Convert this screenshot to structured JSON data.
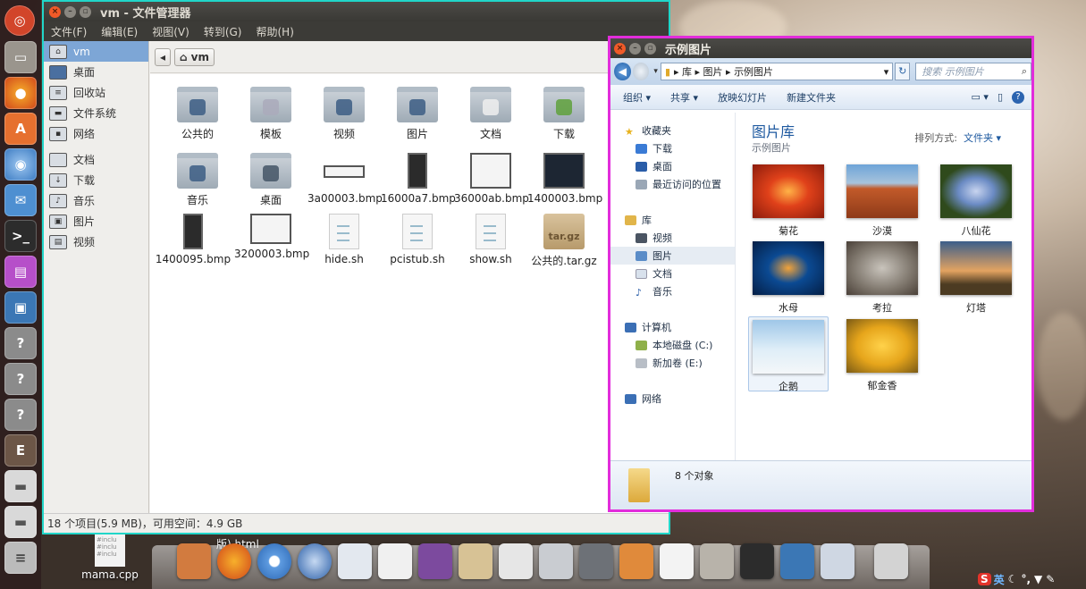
{
  "filemanager": {
    "title": "vm - 文件管理器",
    "menu": [
      "文件(F)",
      "编辑(E)",
      "视图(V)",
      "转到(G)",
      "帮助(H)"
    ],
    "sidebar": [
      "vm",
      "桌面",
      "回收站",
      "文件系统",
      "网络",
      "文档",
      "下载",
      "音乐",
      "图片",
      "视频"
    ],
    "path_button": "vm",
    "files": [
      "公共的",
      "模板",
      "视频",
      "图片",
      "文档",
      "下载",
      "音乐",
      "桌面",
      "3a00003.bmp",
      "16000a7.bmp",
      "36000ab.bmp",
      "1400003.bmp",
      "1400095.bmp",
      "3200003.bmp",
      "hide.sh",
      "pcistub.sh",
      "show.sh",
      "公共的.tar.gz"
    ],
    "tgz_label": "tar.gz",
    "status": "18 个项目(5.9 MB)，可用空间：4.9 GB"
  },
  "explorer": {
    "title": "示例图片",
    "address": [
      "库",
      "图片",
      "示例图片"
    ],
    "search_placeholder": "搜索 示例图片",
    "commands": [
      "组织 ▾",
      "共享 ▾",
      "放映幻灯片",
      "新建文件夹"
    ],
    "nav": {
      "favorites": "收藏夹",
      "fav_items": [
        "下载",
        "桌面",
        "最近访问的位置"
      ],
      "libraries": "库",
      "lib_items": [
        "视频",
        "图片",
        "文档",
        "音乐"
      ],
      "computer": "计算机",
      "drives": [
        "本地磁盘 (C:)",
        "新加卷 (E:)"
      ],
      "network": "网络"
    },
    "library_title": "图片库",
    "library_sub": "示例图片",
    "sort_label": "排列方式:",
    "sort_value": "文件夹 ▾",
    "pictures": [
      "菊花",
      "沙漠",
      "八仙花",
      "水母",
      "考拉",
      "灯塔",
      "企鹅",
      "郁金香"
    ],
    "count": "8 个对象"
  },
  "desktop": {
    "file1": "mama.cpp",
    "file2": "版).html",
    "file1_lines": "#inclu\n#inclu\n#inclu"
  },
  "tray": {
    "ime": "英"
  }
}
